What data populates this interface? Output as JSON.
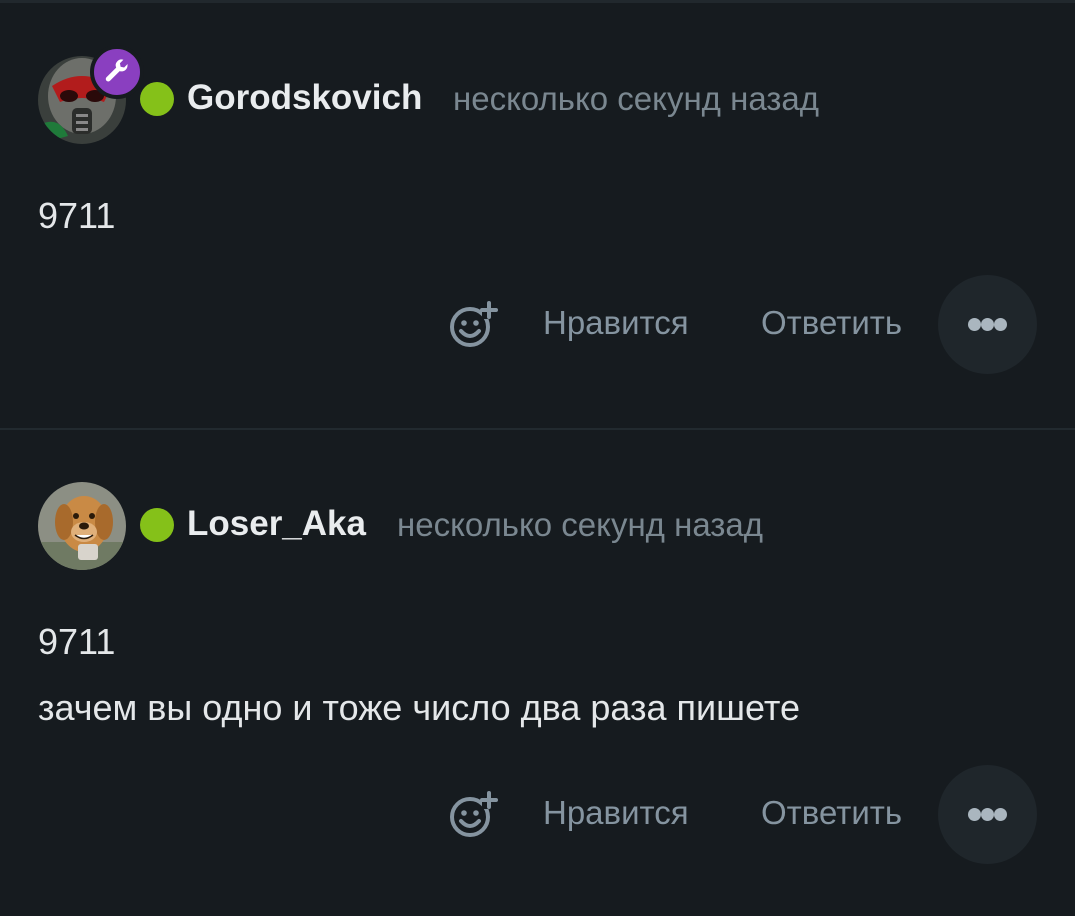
{
  "comments": [
    {
      "username": "Gorodskovich",
      "timestamp": "несколько секунд назад",
      "is_moderator": true,
      "online": true,
      "body": [
        "9711"
      ],
      "actions": {
        "like_label": "Нравится",
        "reply_label": "Ответить"
      }
    },
    {
      "username": "Loser_Aka",
      "timestamp": "несколько секунд назад",
      "is_moderator": false,
      "online": true,
      "body": [
        "9711",
        "зачем вы одно и тоже число два раза пишете"
      ],
      "actions": {
        "like_label": "Нравится",
        "reply_label": "Ответить"
      }
    }
  ],
  "colors": {
    "background": "#161b1f",
    "online": "#85c119",
    "moderator_badge": "#8a3fc0",
    "muted_text": "#7a8790",
    "action_text": "#8594a0"
  },
  "icons": {
    "reaction": "emoji-add-icon",
    "more": "more-dots-icon",
    "moderator": "wrench-icon"
  }
}
